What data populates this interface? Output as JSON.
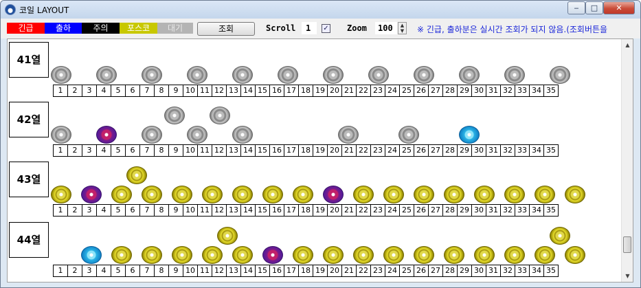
{
  "window": {
    "title": "코일 LAYOUT",
    "icon": "app-icon",
    "controls": [
      "minimize-icon",
      "maximize-icon",
      "close-icon"
    ],
    "minimize_glyph": "‒",
    "maximize_glyph": "□",
    "close_glyph": "✕"
  },
  "toolbar": {
    "legend": [
      {
        "label": "긴급",
        "color": "#ff0000",
        "text_color": "#ffffff"
      },
      {
        "label": "출하",
        "color": "#0000ff",
        "text_color": "#ffffff"
      },
      {
        "label": "주의",
        "color": "#000000",
        "text_color": "#ffffff"
      },
      {
        "label": "포스코",
        "color": "#c8c800",
        "text_color": "#ffffff"
      },
      {
        "label": "대기",
        "color": "#b4b4b4",
        "text_color": "#e8e8e8"
      }
    ],
    "search_button": "조회",
    "scroll_label": "Scroll",
    "scroll_value": "1",
    "scroll_checked": "✓",
    "zoom_label": "Zoom",
    "zoom_value": "100",
    "spin_up": "▲",
    "spin_down": "▼",
    "notice": "※ 긴급, 출하분은 실시간 조회가 되지 않음.(조회버튼을"
  },
  "positions": [
    "1",
    "2",
    "3",
    "4",
    "5",
    "6",
    "7",
    "8",
    "9",
    "10",
    "11",
    "12",
    "13",
    "14",
    "15",
    "16",
    "17",
    "18",
    "19",
    "20",
    "21",
    "22",
    "23",
    "24",
    "25",
    "26",
    "27",
    "28",
    "29",
    "30",
    "31",
    "32",
    "33",
    "34",
    "35"
  ],
  "rows": [
    {
      "label": "41열",
      "coils": [
        {
          "pos": 1,
          "tier": 1,
          "color": "gray"
        },
        {
          "pos": 4,
          "tier": 1,
          "color": "gray"
        },
        {
          "pos": 7,
          "tier": 1,
          "color": "gray"
        },
        {
          "pos": 10,
          "tier": 1,
          "color": "gray"
        },
        {
          "pos": 13,
          "tier": 1,
          "color": "gray"
        },
        {
          "pos": 16,
          "tier": 1,
          "color": "gray"
        },
        {
          "pos": 19,
          "tier": 1,
          "color": "gray"
        },
        {
          "pos": 22,
          "tier": 1,
          "color": "gray"
        },
        {
          "pos": 25,
          "tier": 1,
          "color": "gray"
        },
        {
          "pos": 28,
          "tier": 1,
          "color": "gray"
        },
        {
          "pos": 31,
          "tier": 1,
          "color": "gray"
        },
        {
          "pos": 34,
          "tier": 1,
          "color": "gray"
        }
      ]
    },
    {
      "label": "42열",
      "coils": [
        {
          "pos": 1,
          "tier": 1,
          "color": "gray"
        },
        {
          "pos": 4,
          "tier": 1,
          "color": "purple"
        },
        {
          "pos": 7,
          "tier": 1,
          "color": "gray"
        },
        {
          "pos": 8.5,
          "tier": 2,
          "color": "gray"
        },
        {
          "pos": 10,
          "tier": 1,
          "color": "gray"
        },
        {
          "pos": 11.5,
          "tier": 2,
          "color": "gray"
        },
        {
          "pos": 13,
          "tier": 1,
          "color": "gray"
        },
        {
          "pos": 20,
          "tier": 1,
          "color": "gray"
        },
        {
          "pos": 24,
          "tier": 1,
          "color": "gray"
        },
        {
          "pos": 28,
          "tier": 1,
          "color": "cyan"
        }
      ]
    },
    {
      "label": "43열",
      "coils": [
        {
          "pos": 1,
          "tier": 1,
          "color": "yellow"
        },
        {
          "pos": 3,
          "tier": 1,
          "color": "purple"
        },
        {
          "pos": 5,
          "tier": 1,
          "color": "yellow"
        },
        {
          "pos": 6,
          "tier": 2,
          "color": "yellow"
        },
        {
          "pos": 7,
          "tier": 1,
          "color": "yellow"
        },
        {
          "pos": 9,
          "tier": 1,
          "color": "yellow"
        },
        {
          "pos": 11,
          "tier": 1,
          "color": "yellow"
        },
        {
          "pos": 13,
          "tier": 1,
          "color": "yellow"
        },
        {
          "pos": 15,
          "tier": 1,
          "color": "yellow"
        },
        {
          "pos": 17,
          "tier": 1,
          "color": "yellow"
        },
        {
          "pos": 19,
          "tier": 1,
          "color": "purple"
        },
        {
          "pos": 21,
          "tier": 1,
          "color": "yellow"
        },
        {
          "pos": 23,
          "tier": 1,
          "color": "yellow"
        },
        {
          "pos": 25,
          "tier": 1,
          "color": "yellow"
        },
        {
          "pos": 27,
          "tier": 1,
          "color": "yellow"
        },
        {
          "pos": 29,
          "tier": 1,
          "color": "yellow"
        },
        {
          "pos": 31,
          "tier": 1,
          "color": "yellow"
        },
        {
          "pos": 33,
          "tier": 1,
          "color": "yellow"
        },
        {
          "pos": 35,
          "tier": 1,
          "color": "yellow"
        }
      ]
    },
    {
      "label": "44열",
      "coils": [
        {
          "pos": 3,
          "tier": 1,
          "color": "cyan"
        },
        {
          "pos": 5,
          "tier": 1,
          "color": "yellow"
        },
        {
          "pos": 7,
          "tier": 1,
          "color": "yellow"
        },
        {
          "pos": 9,
          "tier": 1,
          "color": "yellow"
        },
        {
          "pos": 11,
          "tier": 1,
          "color": "yellow"
        },
        {
          "pos": 12,
          "tier": 2,
          "color": "yellow"
        },
        {
          "pos": 13,
          "tier": 1,
          "color": "yellow"
        },
        {
          "pos": 15,
          "tier": 1,
          "color": "purple"
        },
        {
          "pos": 17,
          "tier": 1,
          "color": "yellow"
        },
        {
          "pos": 19,
          "tier": 1,
          "color": "yellow"
        },
        {
          "pos": 21,
          "tier": 1,
          "color": "yellow"
        },
        {
          "pos": 23,
          "tier": 1,
          "color": "yellow"
        },
        {
          "pos": 25,
          "tier": 1,
          "color": "yellow"
        },
        {
          "pos": 27,
          "tier": 1,
          "color": "yellow"
        },
        {
          "pos": 29,
          "tier": 1,
          "color": "yellow"
        },
        {
          "pos": 31,
          "tier": 1,
          "color": "yellow"
        },
        {
          "pos": 33,
          "tier": 1,
          "color": "yellow"
        },
        {
          "pos": 34,
          "tier": 2,
          "color": "yellow"
        },
        {
          "pos": 35,
          "tier": 1,
          "color": "yellow"
        }
      ]
    }
  ],
  "scrollbar": {
    "up": "▲",
    "down": "▼"
  }
}
